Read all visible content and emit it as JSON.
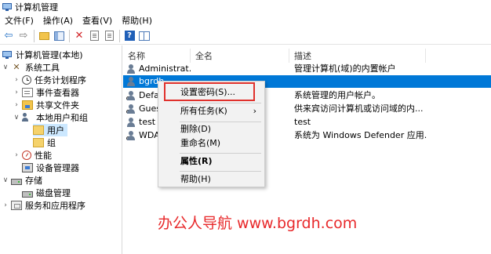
{
  "window": {
    "title": "计算机管理"
  },
  "menubar": {
    "items": [
      "文件(F)",
      "操作(A)",
      "查看(V)",
      "帮助(H)"
    ]
  },
  "tree": {
    "root": "计算机管理(本地)",
    "system_tools": "系统工具",
    "task_scheduler": "任务计划程序",
    "event_viewer": "事件查看器",
    "shared_folders": "共享文件夹",
    "local_users_groups": "本地用户和组",
    "users": "用户",
    "groups": "组",
    "performance": "性能",
    "device_manager": "设备管理器",
    "storage": "存储",
    "disk_management": "磁盘管理",
    "services_apps": "服务和应用程序"
  },
  "list": {
    "columns": [
      "名称",
      "全名",
      "描述"
    ],
    "rows": [
      {
        "name": "Administrat...",
        "full_name": "",
        "description": "管理计算机(域)的内置帐户"
      },
      {
        "name": "bgrdh",
        "full_name": "",
        "description": ""
      },
      {
        "name": "Defa",
        "full_name": "",
        "description": "系统管理的用户帐户。"
      },
      {
        "name": "Gues",
        "full_name": "",
        "description": "供来宾访问计算机或访问域的内..."
      },
      {
        "name": "test",
        "full_name": "",
        "description": "test"
      },
      {
        "name": "WDA",
        "full_name": "",
        "description": "系统为 Windows Defender 应用..."
      }
    ],
    "selected_index": 1
  },
  "context_menu": {
    "set_password": "设置密码(S)...",
    "all_tasks": "所有任务(K)",
    "delete": "删除(D)",
    "rename": "重命名(M)",
    "properties": "属性(R)",
    "help": "帮助(H)",
    "submenu_arrow": "›"
  },
  "watermark": "办公人导航 www.bgrdh.com",
  "colors": {
    "selection": "#0078d7",
    "highlight_box": "#e0312c",
    "watermark": "#e8292b"
  }
}
